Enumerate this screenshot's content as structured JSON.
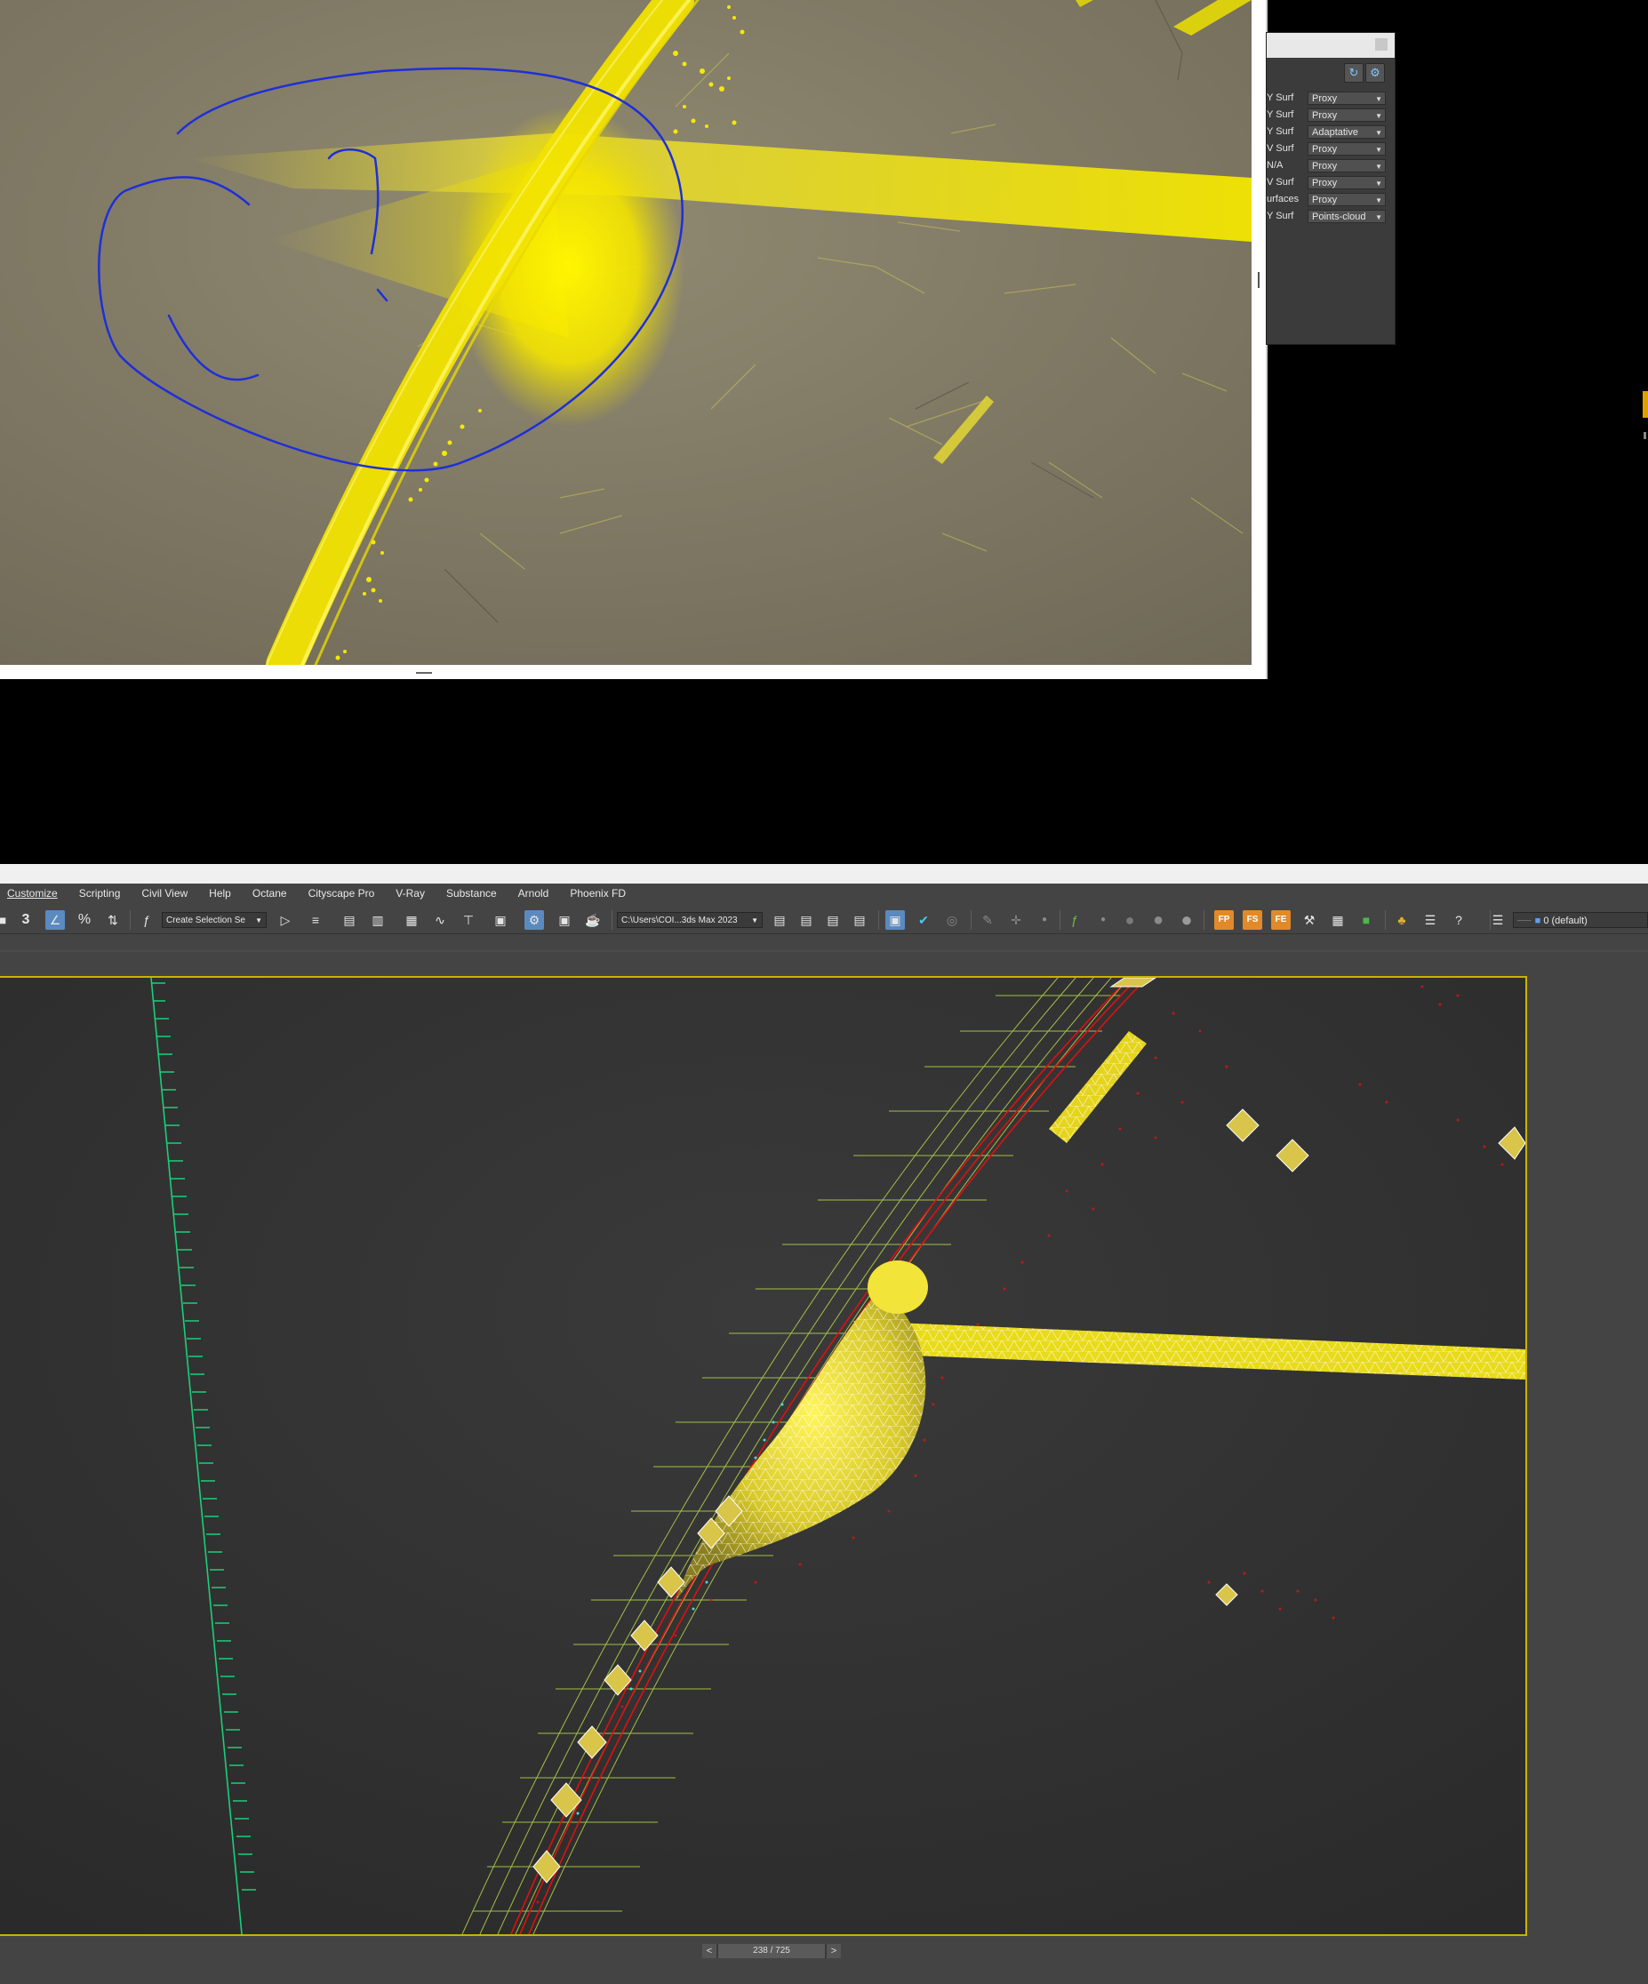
{
  "render_panel": {
    "rows": [
      {
        "label": "Y Surf",
        "mode": "Proxy"
      },
      {
        "label": "Y Surf",
        "mode": "Proxy"
      },
      {
        "label": "Y Surf",
        "mode": "Adaptative"
      },
      {
        "label": "V Surf",
        "mode": "Proxy"
      },
      {
        "label": "N/A",
        "mode": "Proxy"
      },
      {
        "label": "V Surf",
        "mode": "Proxy"
      },
      {
        "label": "urfaces",
        "mode": "Proxy"
      },
      {
        "label": "Y Surf",
        "mode": "Points-cloud"
      }
    ]
  },
  "max": {
    "menu": [
      "Customize",
      "Scripting",
      "Civil View",
      "Help",
      "Octane",
      "Cityscape Pro",
      "V-Ray",
      "Substance",
      "Arnold",
      "Phoenix FD"
    ],
    "toolbar": {
      "selection_set": "Create Selection Se",
      "project_path": "C:\\Users\\COI...3ds Max 2023",
      "layer": "0 (default)",
      "fp_labels": [
        "FP",
        "FS",
        "FE"
      ]
    },
    "timeline": {
      "frame": "238 / 725",
      "prev": "<",
      "next": ">"
    }
  },
  "colors": {
    "particles": "#f0e400",
    "annotation": "#1e2fd8",
    "viewport_border": "#c8b400",
    "wire_red": "#e01010",
    "wire_green": "#19d07a"
  }
}
